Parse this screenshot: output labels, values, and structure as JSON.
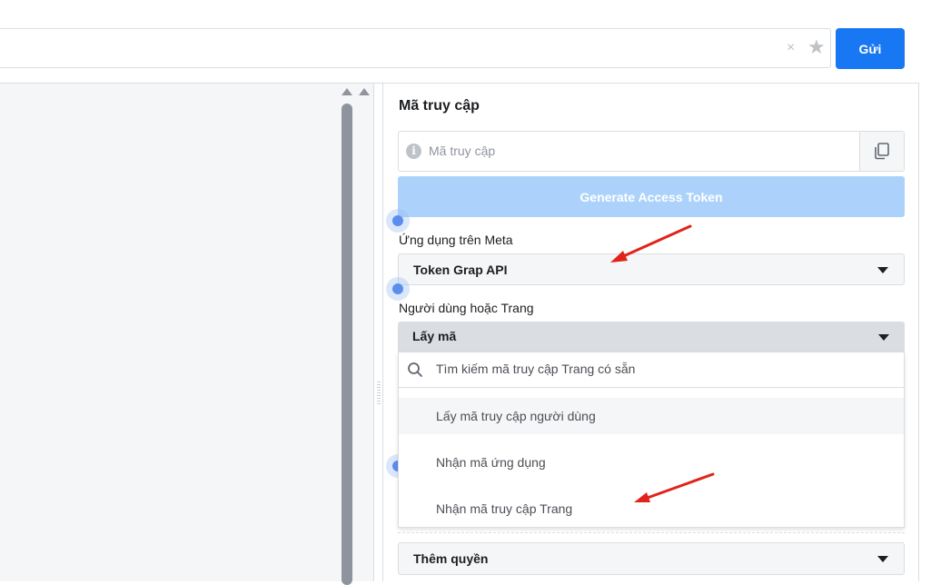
{
  "toolbar": {
    "clear_glyph": "×",
    "star_glyph": "★",
    "submit_label": "Gửi"
  },
  "access_token_panel": {
    "title": "Mã truy cập",
    "token_placeholder": "Mã truy cập",
    "info_glyph": "i",
    "generate_label": "Generate Access Token"
  },
  "app_select": {
    "label": "Ứng dụng trên Meta",
    "value": "Token Grap API"
  },
  "user_or_page": {
    "label": "Người dùng hoặc Trang",
    "value": "Lấy mã",
    "search_placeholder": "Tìm kiếm mã truy cập Trang có sẵn",
    "options": [
      "Lấy mã truy cập người dùng",
      "Nhận mã ứng dụng",
      "Nhận mã truy cập Trang"
    ]
  },
  "permissions_select": {
    "value": "Thêm quyền"
  },
  "colors": {
    "primary": "#1877f2",
    "primary_disabled": "#acd2fb",
    "annotation_arrow": "#e0241b"
  }
}
